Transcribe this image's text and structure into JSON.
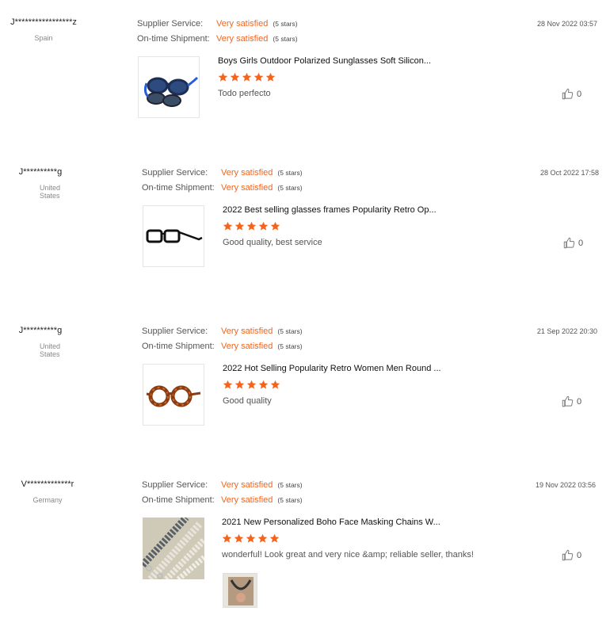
{
  "labels": {
    "supplier_service": "Supplier Service:",
    "ontime_shipment": "On-time Shipment:"
  },
  "colors": {
    "accent": "#f4641c"
  },
  "reviews": [
    {
      "user": "J*****************z",
      "country": "Spain",
      "supplier_value": "Very satisfied",
      "supplier_stars": "(5 stars)",
      "shipment_value": "Very satisfied",
      "shipment_stars": "(5 stars)",
      "date": "28 Nov 2022 03:57",
      "product_title": "Boys Girls Outdoor Polarized Sunglasses Soft Silicon...",
      "rating": 5,
      "comment": "Todo perfecto",
      "likes": "0",
      "product_icon": "blue-sunglasses-image"
    },
    {
      "user": "J**********g",
      "country": "United States",
      "supplier_value": "Very satisfied",
      "supplier_stars": "(5 stars)",
      "shipment_value": "Very satisfied",
      "shipment_stars": "(5 stars)",
      "date": "28 Oct 2022 17:58",
      "product_title": "2022 Best selling glasses frames Popularity Retro Op...",
      "rating": 5,
      "comment": "Good quality, best service",
      "likes": "0",
      "product_icon": "black-glasses-image"
    },
    {
      "user": "J**********g",
      "country": "United States",
      "supplier_value": "Very satisfied",
      "supplier_stars": "(5 stars)",
      "shipment_value": "Very satisfied",
      "shipment_stars": "(5 stars)",
      "date": "21 Sep 2022 20:30",
      "product_title": "2022 Hot Selling Popularity Retro Women Men Round ...",
      "rating": 5,
      "comment": "Good quality",
      "likes": "0",
      "product_icon": "tortoise-glasses-image"
    },
    {
      "user": "V*************r",
      "country": "Germany",
      "supplier_value": "Very satisfied",
      "supplier_stars": "(5 stars)",
      "shipment_value": "Very satisfied",
      "shipment_stars": "(5 stars)",
      "date": "19 Nov 2022 03:56",
      "product_title": "2021 New Personalized Boho Face Masking Chains W...",
      "rating": 5,
      "comment": "wonderful! Look great and very nice &amp; reliable seller, thanks!",
      "likes": "0",
      "product_icon": "mask-chains-image"
    }
  ]
}
